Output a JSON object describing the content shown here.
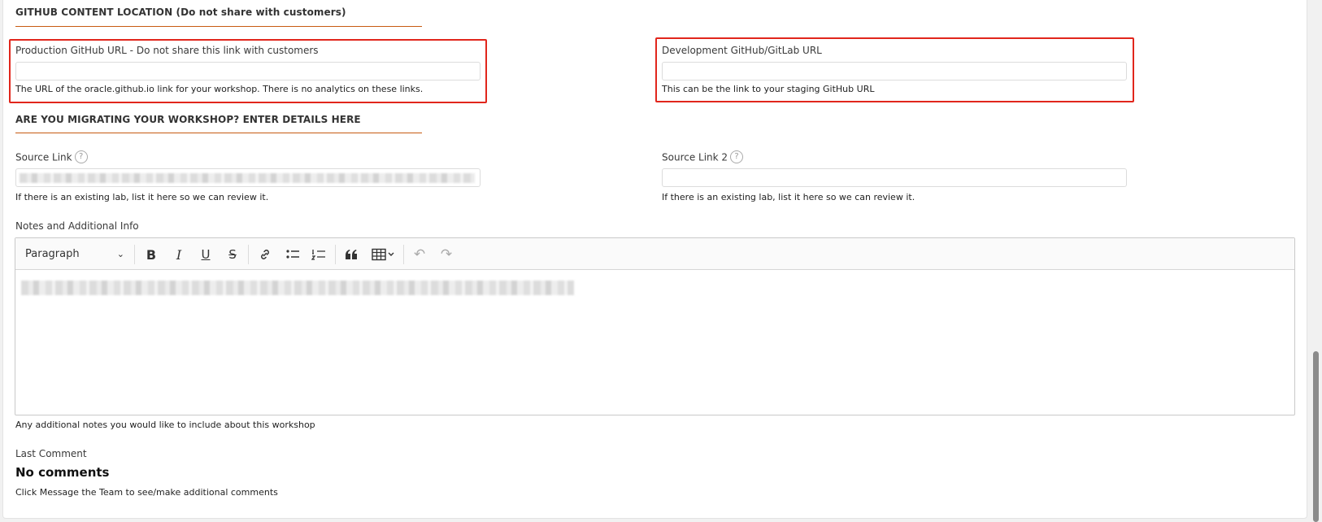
{
  "github_section": {
    "title": "GITHUB CONTENT LOCATION (Do not share with customers)",
    "production_label": "Production GitHub URL - Do not share this link with customers",
    "production_value": "",
    "production_hint": "The URL of the oracle.github.io link for your workshop. There is no analytics on these links.",
    "development_label": "Development GitHub/GitLab URL",
    "development_value": "",
    "development_hint": "This can be the link to your staging GitHub URL"
  },
  "migration_section": {
    "title": "ARE YOU MIGRATING YOUR WORKSHOP? ENTER DETAILS HERE",
    "source_link_label": "Source Link",
    "source_link_hint": "If there is an existing lab, list it here so we can review it.",
    "source_link2_label": "Source Link 2",
    "source_link2_value": "",
    "source_link2_hint": "If there is an existing lab, list it here so we can review it."
  },
  "notes": {
    "label": "Notes and Additional Info",
    "paragraph_style": "Paragraph",
    "hint": "Any additional notes you would like to include about this workshop"
  },
  "toolbar_icons": {
    "help": "?",
    "chevron": "⌄",
    "bold": "B",
    "italic": "I",
    "underline": "U",
    "strike": "S",
    "link": "🔗",
    "bullets": "☰",
    "numbered": "☷",
    "quote": "❝",
    "table": "▦",
    "undo": "↶",
    "redo": "↷"
  },
  "comments": {
    "label": "Last Comment",
    "value": "No comments",
    "hint": "Click Message the Team to see/make additional comments"
  },
  "colors": {
    "accent": "#c75b12",
    "highlight": "#e1261c"
  }
}
